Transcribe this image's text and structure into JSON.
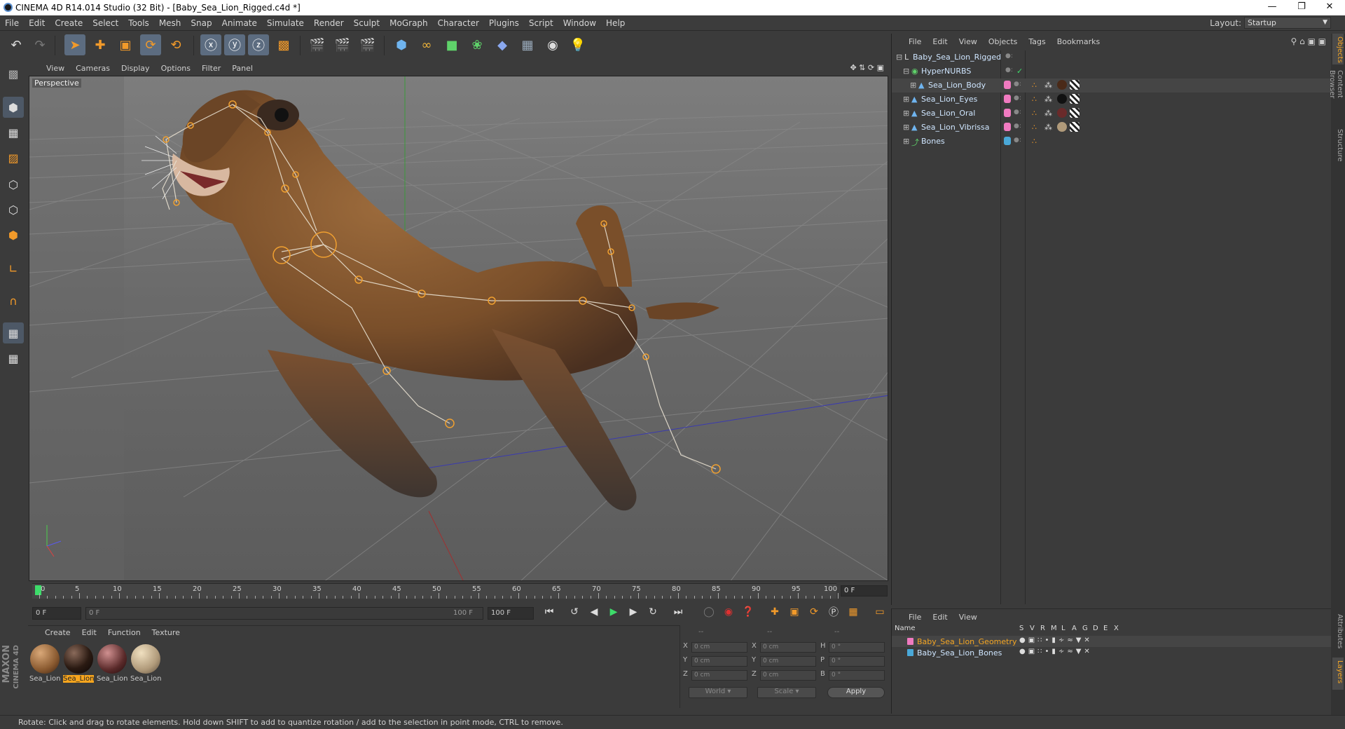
{
  "window": {
    "title": "CINEMA 4D R14.014 Studio (32 Bit) - [Baby_Sea_Lion_Rigged.c4d *]"
  },
  "menubar": {
    "items": [
      "File",
      "Edit",
      "Create",
      "Select",
      "Tools",
      "Mesh",
      "Snap",
      "Animate",
      "Simulate",
      "Render",
      "Sculpt",
      "MoGraph",
      "Character",
      "Plugins",
      "Script",
      "Window",
      "Help"
    ]
  },
  "layout": {
    "label": "Layout:",
    "value": "Startup"
  },
  "viewport": {
    "menu": [
      "View",
      "Cameras",
      "Display",
      "Options",
      "Filter",
      "Panel"
    ],
    "label": "Perspective"
  },
  "timeline": {
    "ticks": [
      "0",
      "5",
      "10",
      "15",
      "20",
      "25",
      "30",
      "35",
      "40",
      "45",
      "50",
      "55",
      "60",
      "65",
      "70",
      "75",
      "80",
      "85",
      "90",
      "95",
      "100"
    ],
    "current_frame": "0 F",
    "start_field": "0 F",
    "range_start": "0 F",
    "range_end": "100 F",
    "end_field": "100 F"
  },
  "materials": {
    "menu": [
      "Create",
      "Edit",
      "Function",
      "Texture"
    ],
    "items": [
      {
        "label": "Sea_Lion",
        "color": "#8a5a30"
      },
      {
        "label": "Sea_Lion",
        "color": "#2a1a12"
      },
      {
        "label": "Sea_Lion",
        "color": "#5a2a2a"
      },
      {
        "label": "Sea_Lion",
        "color": "#b09a7a"
      }
    ]
  },
  "coords": {
    "header": [
      "--",
      "--",
      "--"
    ],
    "rows": [
      {
        "a": "X",
        "av": "0 cm",
        "b": "X",
        "bv": "0 cm",
        "c": "H",
        "cv": "0 °"
      },
      {
        "a": "Y",
        "av": "0 cm",
        "b": "Y",
        "bv": "0 cm",
        "c": "P",
        "cv": "0 °"
      },
      {
        "a": "Z",
        "av": "0 cm",
        "b": "Z",
        "bv": "0 cm",
        "c": "B",
        "cv": "0 °"
      }
    ],
    "world": "World",
    "scale": "Scale",
    "apply": "Apply"
  },
  "objects": {
    "menu": [
      "File",
      "Edit",
      "View",
      "Objects",
      "Tags",
      "Bookmarks"
    ],
    "tree": [
      {
        "name": "Baby_Sea_Lion_Rigged",
        "indent": 0,
        "color": null
      },
      {
        "name": "HyperNURBS",
        "indent": 1,
        "color": null
      },
      {
        "name": "Sea_Lion_Body",
        "indent": 2,
        "color": "#f07ac0"
      },
      {
        "name": "Sea_Lion_Eyes",
        "indent": 1,
        "color": "#f07ac0"
      },
      {
        "name": "Sea_Lion_Oral",
        "indent": 1,
        "color": "#f07ac0"
      },
      {
        "name": "Sea_Lion_Vibrissa",
        "indent": 1,
        "color": "#f07ac0"
      },
      {
        "name": "Bones",
        "indent": 1,
        "color": "#4aa8d8"
      }
    ]
  },
  "layers": {
    "menu": [
      "File",
      "Edit",
      "View"
    ],
    "headers": [
      "Name",
      "S",
      "V",
      "R",
      "M",
      "L",
      "A",
      "G",
      "D",
      "E",
      "X"
    ],
    "rows": [
      {
        "name": "Baby_Sea_Lion_Geometry",
        "color": "#f07ac0",
        "selected": true
      },
      {
        "name": "Baby_Sea_Lion_Bones",
        "color": "#4aa8d8",
        "selected": false
      }
    ]
  },
  "sidetabs": [
    "Objects",
    "Content Browser",
    "Structure",
    "Attributes",
    "Layers"
  ],
  "status": "Rotate: Click and drag to rotate elements. Hold down SHIFT to add to quantize rotation / add to the selection in point mode, CTRL to remove.",
  "branding": {
    "line1": "MAXON",
    "line2": "CINEMA 4D"
  }
}
